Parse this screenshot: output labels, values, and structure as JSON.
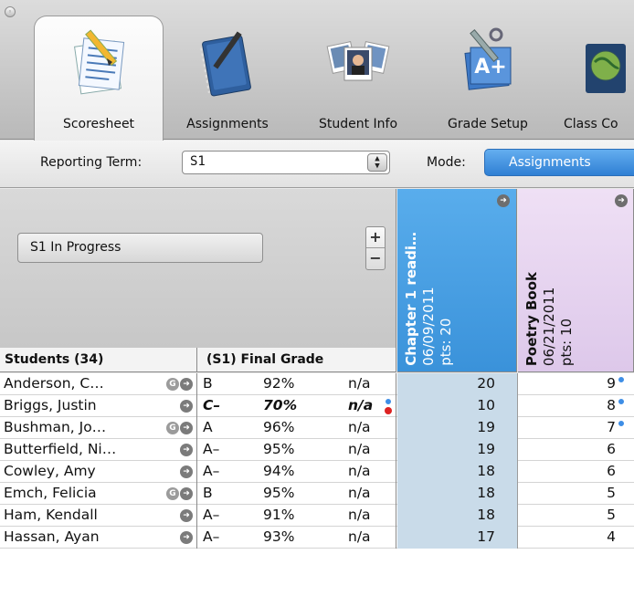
{
  "toolbar": {
    "items": [
      {
        "label": "Scoresheet",
        "icon": "scoresheet-icon"
      },
      {
        "label": "Assignments",
        "icon": "notebook-icon"
      },
      {
        "label": "Student Info",
        "icon": "student-photos-icon"
      },
      {
        "label": "Grade Setup",
        "icon": "grade-setup-icon"
      },
      {
        "label": "Class Co",
        "icon": "globe-book-icon"
      }
    ],
    "active": "Scoresheet"
  },
  "filter": {
    "reporting_term_label": "Reporting Term:",
    "reporting_term_value": "S1",
    "mode_label": "Mode:",
    "mode_value": "Assignments"
  },
  "left_panel": {
    "term_button": "S1 In Progress",
    "plus": "+",
    "minus": "−"
  },
  "grid": {
    "students_header": "Students (34)",
    "final_grade_header": "(S1) Final Grade",
    "assignments": [
      {
        "title": "Chapter 1 readi…",
        "date": "06/09/2011",
        "pts": "pts: 20",
        "color": "#4aa0e4"
      },
      {
        "title": "Poetry Book",
        "date": "06/21/2011",
        "pts": "pts: 10",
        "color": "#e6d2ef"
      }
    ],
    "rows": [
      {
        "name": "Anderson, C…",
        "g": true,
        "letter": "B",
        "pct": "92%",
        "status": "n/a",
        "a1": "20",
        "a2": "9",
        "a2_flag": true
      },
      {
        "name": "Briggs, Justin",
        "g": false,
        "letter": "C–",
        "pct": "70%",
        "status": "n/a",
        "emph": true,
        "status_flags": true,
        "a1": "10",
        "a2": "8",
        "a2_flag": true
      },
      {
        "name": "Bushman, Jo…",
        "g": true,
        "letter": "A",
        "pct": "96%",
        "status": "n/a",
        "a1": "19",
        "a2": "7",
        "a2_flag": true
      },
      {
        "name": "Butterfield, Ni…",
        "g": false,
        "letter": "A–",
        "pct": "95%",
        "status": "n/a",
        "a1": "19",
        "a2": "6"
      },
      {
        "name": "Cowley, Amy",
        "g": false,
        "letter": "A–",
        "pct": "94%",
        "status": "n/a",
        "a1": "18",
        "a2": "6"
      },
      {
        "name": "Emch, Felicia",
        "g": true,
        "letter": "B",
        "pct": "95%",
        "status": "n/a",
        "a1": "18",
        "a2": "5"
      },
      {
        "name": "Ham, Kendall",
        "g": false,
        "letter": "A–",
        "pct": "91%",
        "status": "n/a",
        "a1": "18",
        "a2": "5"
      },
      {
        "name": "Hassan, Ayan",
        "g": false,
        "letter": "A–",
        "pct": "93%",
        "status": "n/a",
        "a1": "17",
        "a2": "4"
      }
    ]
  }
}
